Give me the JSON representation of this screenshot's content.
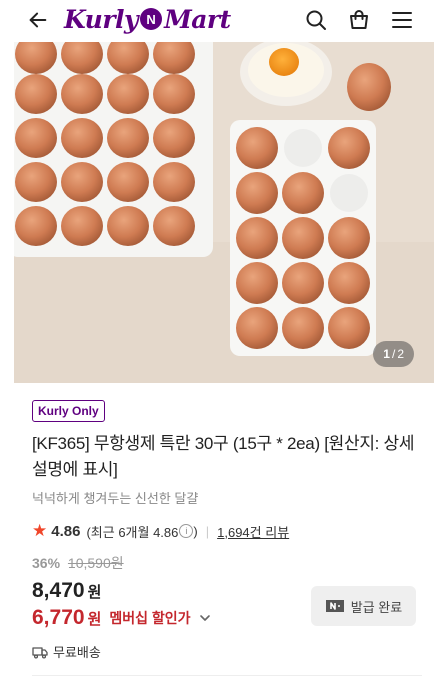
{
  "header": {
    "back_icon": "arrow-left-icon",
    "logo_left": "Kurly",
    "logo_badge": "N",
    "logo_right": "Mart",
    "icons": [
      "search-icon",
      "bag-icon",
      "menu-icon"
    ],
    "brand_color": "#5f0080"
  },
  "gallery": {
    "current": "1",
    "divider": "/",
    "total": "2"
  },
  "product": {
    "badge": "Kurly Only",
    "title": "[KF365] 무항생제 특란 30구 (15구 * 2ea) [원산지: 상세설명에 표시]",
    "subtitle": "넉넉하게 챙겨두는 신선한 달걀",
    "rating": "4.86",
    "rating_detail_prefix": "(최근 6개월 4.86",
    "rating_detail_suffix": ")",
    "review_link": "1,694건 리뷰"
  },
  "price": {
    "discount": "36%",
    "original": "10,590원",
    "sale": "8,470",
    "sale_unit": "원",
    "member_price": "6,770",
    "member_unit": "원",
    "member_label": "멤버십 할인가",
    "discount_color": "#c4272d"
  },
  "shipping": {
    "label": "무료배송"
  },
  "coupon": {
    "label": "발급 완료"
  }
}
